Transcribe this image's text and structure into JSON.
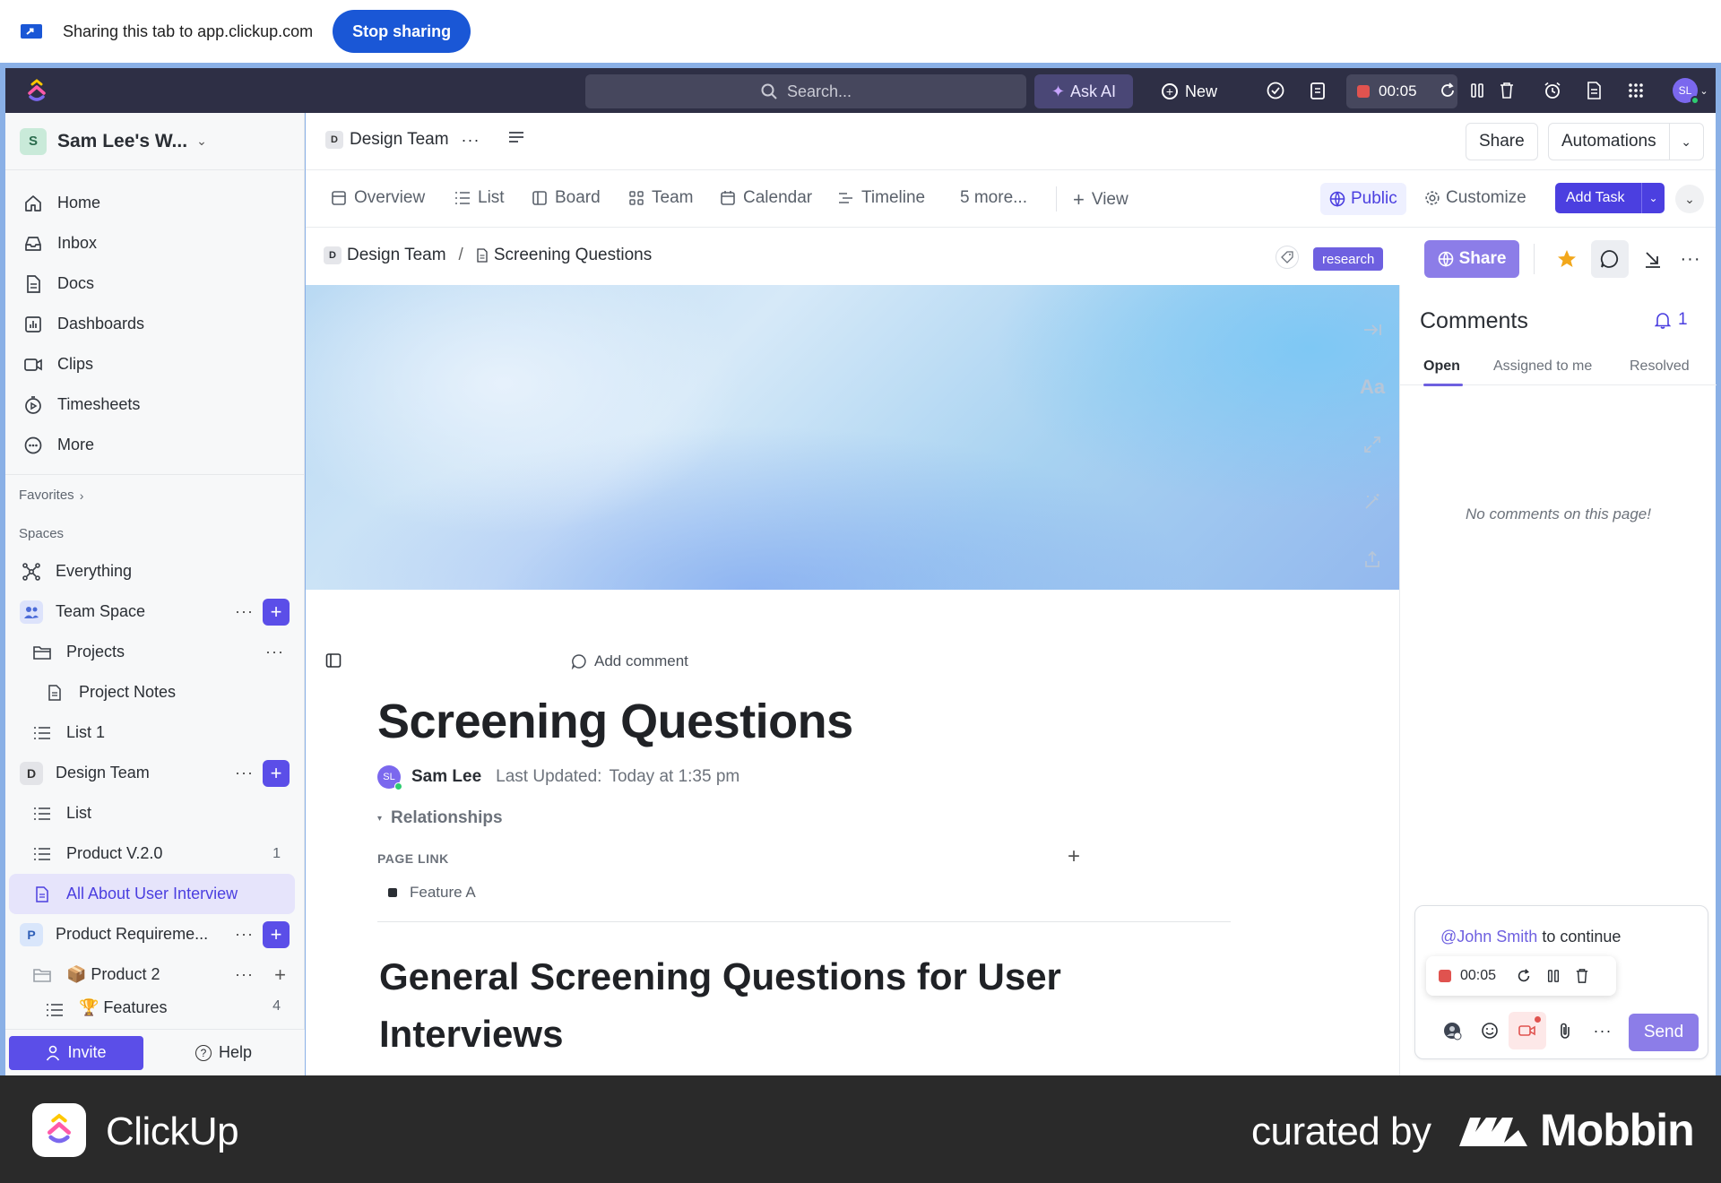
{
  "sharing_bar": {
    "text": "Sharing this tab to app.clickup.com",
    "stop_label": "Stop sharing"
  },
  "topbar": {
    "search_placeholder": "Search...",
    "ask_ai_label": "Ask AI",
    "new_label": "New",
    "timer": "00:05",
    "avatar_initials": "SL"
  },
  "sidebar": {
    "workspace": {
      "badge": "S",
      "name": "Sam Lee's W..."
    },
    "nav": [
      {
        "label": "Home",
        "icon": "home-icon"
      },
      {
        "label": "Inbox",
        "icon": "inbox-icon"
      },
      {
        "label": "Docs",
        "icon": "docs-icon"
      },
      {
        "label": "Dashboards",
        "icon": "dashboard-icon"
      },
      {
        "label": "Clips",
        "icon": "clips-icon"
      },
      {
        "label": "Timesheets",
        "icon": "timesheet-icon"
      },
      {
        "label": "More",
        "icon": "more-icon"
      }
    ],
    "favorites_label": "Favorites",
    "spaces_label": "Spaces",
    "tree": {
      "everything": "Everything",
      "team_space": "Team Space",
      "projects": "Projects",
      "project_notes": "Project Notes",
      "list1": "List 1",
      "design_team": "Design Team",
      "design_badge": "D",
      "list": "List",
      "product_v2": "Product V.2.0",
      "product_v2_count": "1",
      "all_about": "All About User Interview",
      "product_req": "Product Requireme...",
      "product_req_badge": "P",
      "product2": "📦 Product 2",
      "features": "🏆 Features",
      "features_count": "4"
    },
    "invite_label": "Invite",
    "help_label": "Help"
  },
  "header": {
    "space_badge": "D",
    "space_name": "Design Team",
    "share_label": "Share",
    "automations_label": "Automations"
  },
  "views": {
    "tabs": [
      "Overview",
      "List",
      "Board",
      "Team",
      "Calendar",
      "Timeline",
      "5 more..."
    ],
    "add_view_label": "View",
    "public_label": "Public",
    "customize_label": "Customize",
    "add_task_label": "Add Task"
  },
  "doc_bar": {
    "space_badge": "D",
    "space_name": "Design Team",
    "page_name": "Screening Questions",
    "tag": "research",
    "share_label": "Share"
  },
  "doc": {
    "add_comment_label": "Add comment",
    "title": "Screening Questions",
    "author_initials": "SL",
    "author": "Sam Lee",
    "last_updated_label": "Last Updated:",
    "last_updated_value": "Today at 1:35 pm",
    "relationships_label": "Relationships",
    "page_link_label": "PAGE LINK",
    "page_link_item": "Feature A",
    "heading": "General Screening Questions for User Interviews",
    "side_tool_text": "Aa"
  },
  "comments": {
    "title": "Comments",
    "notification_count": "1",
    "tabs": [
      "Open",
      "Assigned to me",
      "Resolved"
    ],
    "empty_text": "No comments on this page!",
    "mention": "@John Smith",
    "mention_suffix": " to continue",
    "timer": "00:05",
    "send_label": "Send"
  },
  "footer": {
    "app_name": "ClickUp",
    "curated_by": "curated by",
    "brand": "Mobbin"
  },
  "colors": {
    "accent": "#5b4ee8",
    "topbar": "#2e2f45",
    "share_blue": "#1a57d6",
    "record_red": "#e0534f"
  }
}
